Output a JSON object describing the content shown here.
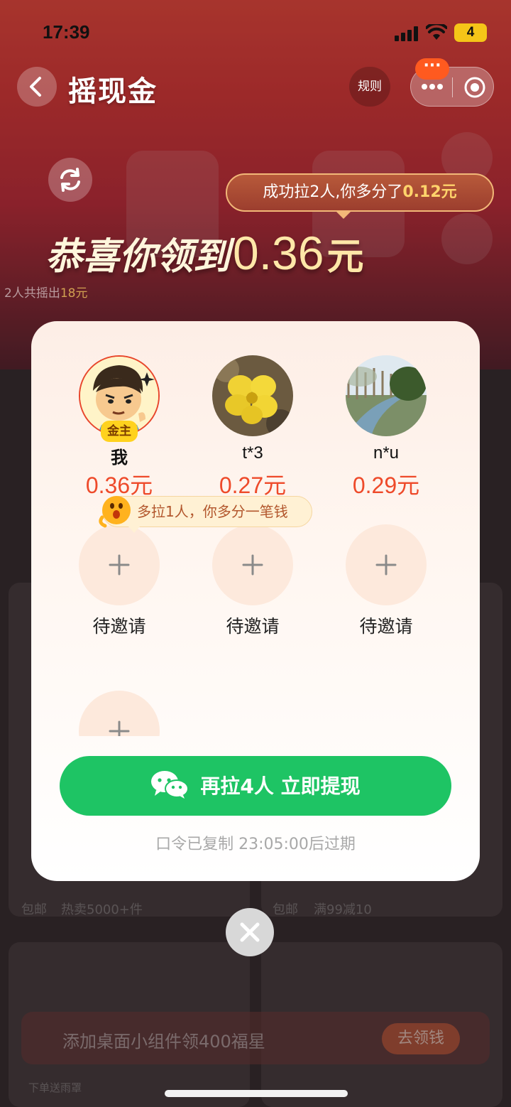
{
  "status_bar": {
    "time": "17:39",
    "battery": "4"
  },
  "nav": {
    "title": "摇现金",
    "rules_label": "规则",
    "badge": "···"
  },
  "header": {
    "bubble_prefix": "成功拉2人,你多分了",
    "bubble_amount": "0.12元",
    "headline_text": "恭喜你领到",
    "headline_amount": "0.36",
    "headline_unit": "元",
    "shake_total_prefix": "2人共摇出",
    "shake_total_amount": "18元"
  },
  "members": [
    {
      "name": "我",
      "amount": "0.36元",
      "badge": "金主"
    },
    {
      "name": "t*3",
      "amount": "0.27元"
    },
    {
      "name": "n*u",
      "amount": "0.29元"
    }
  ],
  "hint": "多拉1人，你多分一笔钱",
  "slots": [
    {
      "label": "待邀请"
    },
    {
      "label": "待邀请"
    },
    {
      "label": "待邀请"
    }
  ],
  "cta": {
    "label": "再拉4人 立即提现"
  },
  "code_note": "口令已复制 23:05:00后过期",
  "background": {
    "widget_text": "添加桌面小组件领400福星",
    "widget_button": "去领钱",
    "tag_left_1": "包邮",
    "tag_left_2": "热卖5000+件",
    "tag_right_1": "包邮",
    "tag_right_2": "满99减10",
    "bottom_caption": "下单送雨罩"
  },
  "colors": {
    "accent_green": "#1ec464",
    "amount_red": "#ee4a2a",
    "badge_yellow": "#ffd21e"
  }
}
